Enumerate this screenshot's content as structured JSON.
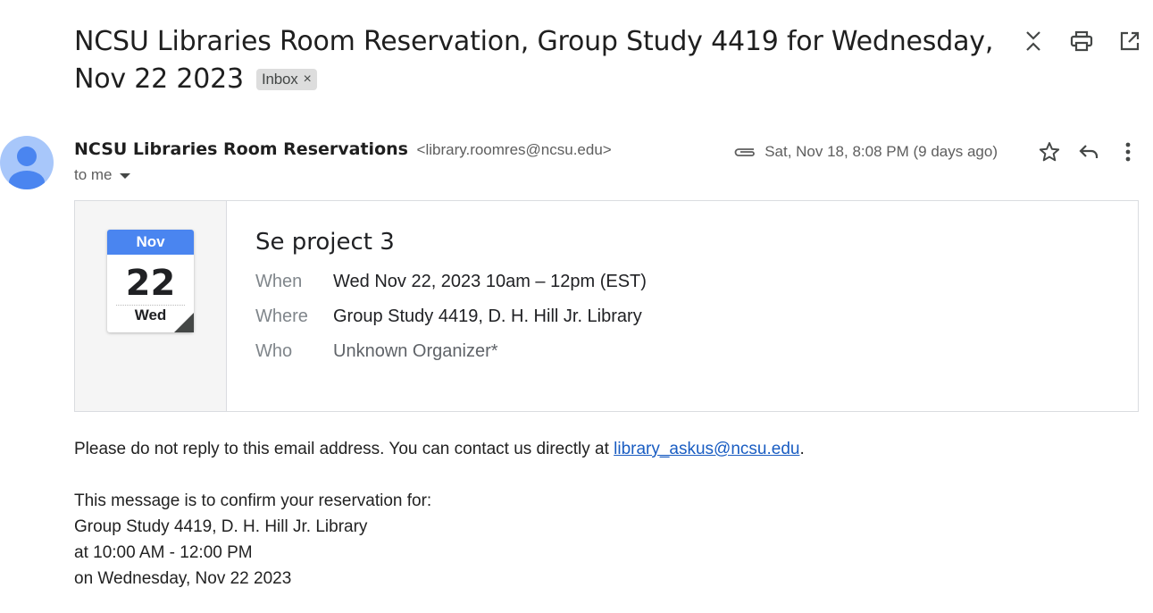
{
  "email": {
    "subject": "NCSU Libraries Room Reservation, Group Study 4419 for Wednesday, Nov 22 2023",
    "label": "Inbox",
    "label_remove": "×",
    "sender": {
      "name": "NCSU Libraries Room Reservations",
      "email": "<library.roomres@ncsu.edu>",
      "to": "to me"
    },
    "date": "Sat, Nov 18, 8:08 PM (9 days ago)"
  },
  "calendar": {
    "month": "Nov",
    "day": "22",
    "weekday": "Wed",
    "title": "Se project 3",
    "when_label": "When",
    "when_value": "Wed Nov 22, 2023 10am – 12pm (EST)",
    "where_label": "Where",
    "where_value": "Group Study 4419, D. H. Hill Jr. Library",
    "who_label": "Who",
    "who_value": "Unknown Organizer*"
  },
  "body": {
    "line1_prefix": "Please do not reply to this email address. You can contact us directly at ",
    "contact_link": "library_askus@ncsu.edu",
    "line1_suffix": ".",
    "confirm": "This message is to confirm your reservation for:",
    "room": "Group Study 4419, D. H. Hill Jr. Library",
    "time": "at 10:00 AM - 12:00 PM",
    "day": "on Wednesday, Nov 22 2023"
  },
  "icons": {
    "collapse": "expand-collapse-icon",
    "print": "print-icon",
    "popout": "open-in-new-window-icon",
    "attachment": "paperclip-icon",
    "star": "star-icon",
    "reply": "reply-icon",
    "more": "more-vert-icon"
  },
  "colors": {
    "avatar_bg": "#a8c7fa",
    "avatar_fg": "#4a85f0",
    "calendar_header": "#4a85f0",
    "link": "#1a5dc2"
  }
}
